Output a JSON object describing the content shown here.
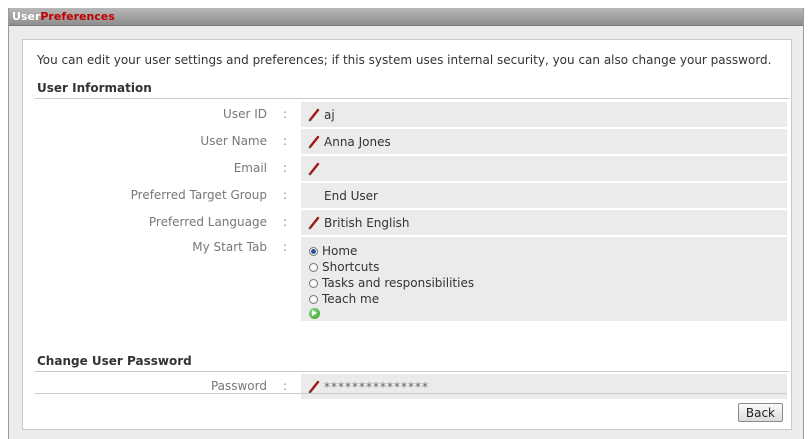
{
  "window": {
    "title_part1": "User",
    "title_part2": "Preferences"
  },
  "intro_text": "You can edit your user settings and preferences; if this system uses internal security, you can also change your password.",
  "user_info": {
    "header": "User Information",
    "separator": ":",
    "fields": [
      {
        "label": "User ID",
        "value": "aj",
        "editable": true
      },
      {
        "label": "User Name",
        "value": "Anna Jones",
        "editable": true
      },
      {
        "label": "Email",
        "value": "",
        "editable": true
      },
      {
        "label": "Preferred Target Group",
        "value": "End User",
        "editable": false
      },
      {
        "label": "Preferred Language",
        "value": "British English",
        "editable": true
      }
    ],
    "start_tab": {
      "label": "My Start Tab",
      "options": [
        "Home",
        "Shortcuts",
        "Tasks and responsibilities",
        "Teach me"
      ],
      "selected": "Home"
    }
  },
  "password": {
    "header": "Change User Password",
    "label": "Password",
    "value": "***************"
  },
  "buttons": {
    "back": "Back"
  },
  "colors": {
    "accent": "#c00000",
    "pencil": "#a01818",
    "go": "#2f9a25"
  }
}
